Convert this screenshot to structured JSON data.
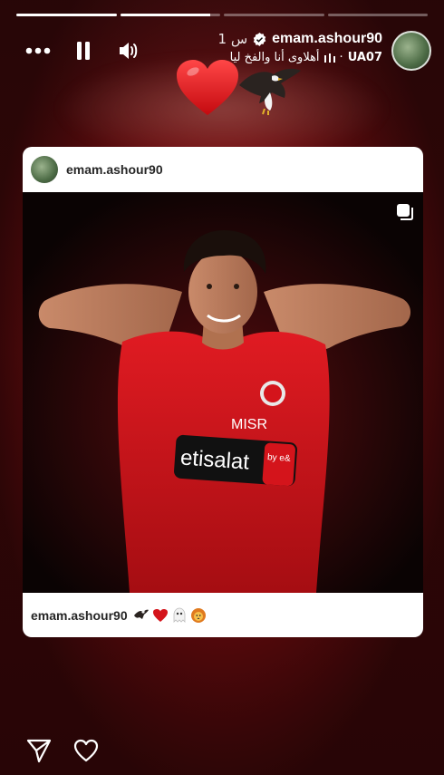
{
  "story": {
    "progress": [
      1.0,
      0.9,
      0.0,
      0.0
    ],
    "username": "emam.ashour90",
    "time_ago": "1 س",
    "verified": true,
    "music": {
      "text": "أهلاوى أنا والفخ ليا",
      "separator": "·",
      "artist": "UA07"
    }
  },
  "controls": {
    "more_icon": "more-horizontal-icon",
    "pause_icon": "pause-icon",
    "volume_icon": "volume-icon"
  },
  "stickers": {
    "heart": "red-heart-icon",
    "eagle": "eagle-icon"
  },
  "post": {
    "username": "emam.ashour90",
    "caption_user": "emam.ashour90",
    "caption_emojis": [
      "eagle-icon",
      "red-heart-icon",
      "ghost-icon",
      "lion-icon"
    ],
    "jersey_sponsor": "etisalat",
    "jersey_sponsor_sub": "by e&",
    "jersey_brand": "MISR"
  },
  "actions": {
    "share_icon": "send-icon",
    "like_icon": "heart-outline-icon"
  },
  "colors": {
    "accent_red": "#d4141b",
    "background_red": "#8a1216"
  }
}
